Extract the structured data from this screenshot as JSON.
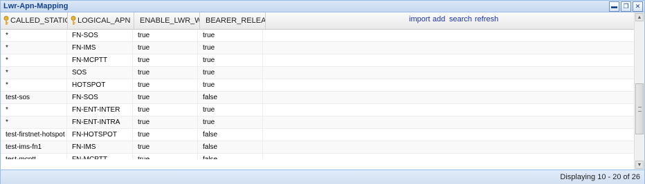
{
  "window": {
    "title": "Lwr-Apn-Mapping",
    "tool_minimize": "▬",
    "tool_restore": "❐",
    "tool_close": "✕"
  },
  "columns": [
    {
      "label": "CALLED_STATIO",
      "key": true
    },
    {
      "label": "LOGICAL_APN",
      "key": true
    },
    {
      "label": "ENABLE_LWR_WR",
      "key": false
    },
    {
      "label": "BEARER_RELEASI",
      "key": false
    }
  ],
  "actions": {
    "import": "import",
    "add": "add",
    "search": "search",
    "refresh": "refresh"
  },
  "rows": [
    [
      "*",
      "FN-SOS",
      "true",
      "true"
    ],
    [
      "*",
      "FN-IMS",
      "true",
      "true"
    ],
    [
      "*",
      "FN-MCPTT",
      "true",
      "true"
    ],
    [
      "*",
      "SOS",
      "true",
      "true"
    ],
    [
      "*",
      "HOTSPOT",
      "true",
      "true"
    ],
    [
      "test-sos",
      "FN-SOS",
      "true",
      "false"
    ],
    [
      "*",
      "FN-ENT-INTER",
      "true",
      "true"
    ],
    [
      "*",
      "FN-ENT-INTRA",
      "true",
      "true"
    ],
    [
      "test-firstnet-hotspot",
      "FN-HOTSPOT",
      "true",
      "false"
    ],
    [
      "test-ims-fn1",
      "FN-IMS",
      "true",
      "false"
    ],
    [
      "test-mcptt",
      "FN-MCPTT",
      "true",
      "false"
    ]
  ],
  "scroll": {
    "up": "▲",
    "down": "▼",
    "position": 0.55
  },
  "footer": {
    "status": "Displaying 10 - 20 of 26"
  },
  "colors": {
    "title": "#15428b",
    "link": "#1a32b4",
    "border": "#99bbe8"
  }
}
